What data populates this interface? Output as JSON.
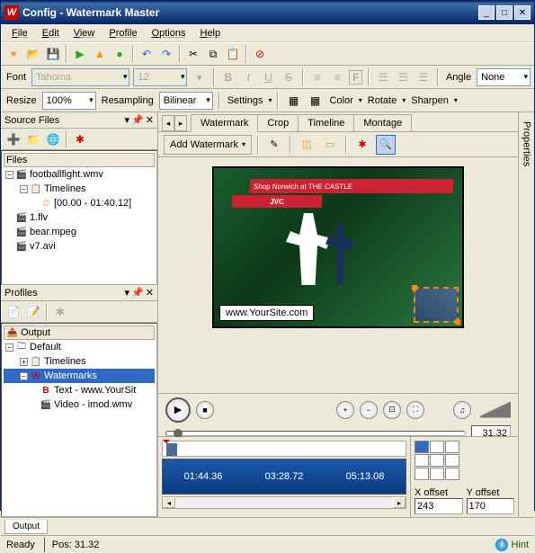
{
  "window": {
    "title": "Config - Watermark Master"
  },
  "menu": [
    "File",
    "Edit",
    "View",
    "Profile",
    "Options",
    "Help"
  ],
  "toolbar2": {
    "font_label": "Font",
    "font_value": "Tahoma",
    "size_value": "12",
    "angle_label": "Angle",
    "angle_value": "None"
  },
  "toolbar3": {
    "resize_label": "Resize",
    "resize_value": "100%",
    "resampling_label": "Resampling",
    "resampling_value": "Bilinear",
    "settings_label": "Settings",
    "color_label": "Color",
    "rotate_label": "Rotate",
    "sharpen_label": "Sharpen"
  },
  "source": {
    "title": "Source Files",
    "files_hdr": "Files",
    "items": [
      {
        "name": "footballfight.wmv",
        "tl": "Timelines",
        "range": "[00.00 - 01:40.12]"
      },
      {
        "name": "1.flv"
      },
      {
        "name": "bear.mpeg"
      },
      {
        "name": "v7.avi"
      }
    ]
  },
  "profiles": {
    "title": "Profiles",
    "output_hdr": "Output",
    "default_label": "Default",
    "timelines_label": "Timelines",
    "watermarks_label": "Watermarks",
    "text_item": "Text - www.YourSit",
    "video_item": "Video - imod.wmv"
  },
  "tabs": {
    "items": [
      "Watermark",
      "Crop",
      "Timeline",
      "Montage"
    ],
    "active": 0
  },
  "wm": {
    "add_label": "Add Watermark",
    "overlay_text": "www.YourSite.com",
    "banner1": "Shop Norwich at THE CASTLE",
    "banner2": "JVC"
  },
  "playback": {
    "time": "31.32"
  },
  "timeline": {
    "marks": [
      "01:44.36",
      "03:28.72",
      "05:13.08"
    ]
  },
  "offsets": {
    "x_label": "X offset",
    "y_label": "Y offset",
    "x_value": "243",
    "y_value": "170"
  },
  "bottom_tab": "Output",
  "status": {
    "ready": "Ready",
    "pos_label": "Pos:",
    "pos_value": "31.32",
    "hint": "Hint"
  },
  "side_panel": "Properties"
}
